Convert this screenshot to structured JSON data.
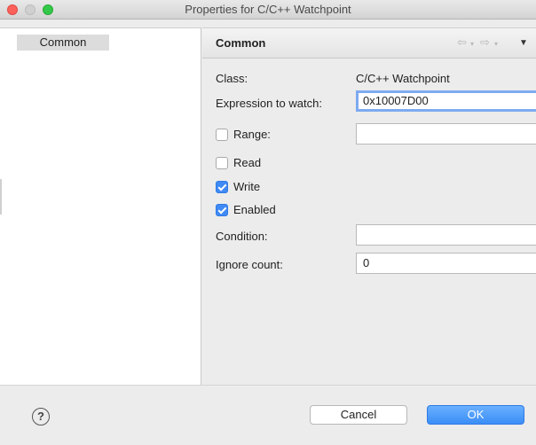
{
  "window": {
    "title": "Properties for C/C++ Watchpoint"
  },
  "left_nav": {
    "items": [
      {
        "label": "Common"
      }
    ]
  },
  "header": {
    "title": "Common",
    "nav_icons": [
      "back-arrow-icon",
      "forward-arrow-icon",
      "view-menu-icon"
    ]
  },
  "form": {
    "class_label": "Class:",
    "class_value": "C/C++ Watchpoint",
    "expression_label": "Expression to watch:",
    "expression_value": "0x10007D00",
    "range_label": "Range:",
    "range_value": "",
    "range_checked": false,
    "read_label": "Read",
    "read_checked": false,
    "write_label": "Write",
    "write_checked": true,
    "enabled_label": "Enabled",
    "enabled_checked": true,
    "condition_label": "Condition:",
    "condition_value": "",
    "ignore_label": "Ignore count:",
    "ignore_value": "0"
  },
  "footer": {
    "help_symbol": "?",
    "cancel_label": "Cancel",
    "ok_label": "OK"
  },
  "colors": {
    "accent": "#3f8af5",
    "focus": "#7eaaf0"
  }
}
